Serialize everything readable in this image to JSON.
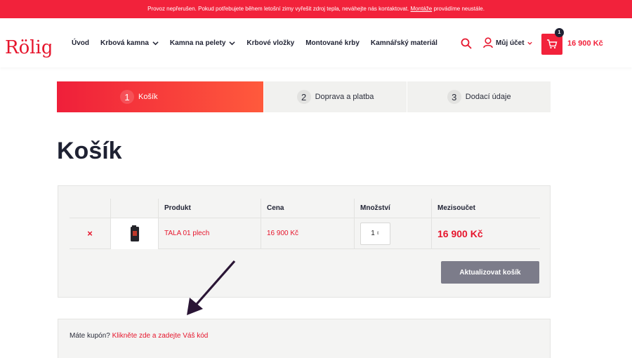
{
  "topbar": {
    "text": "Provoz nepřerušen. Pokud potřebujete během letošní zimy vyřešit zdroj tepla, neváhejte nás kontaktovat.",
    "link": "Montáže",
    "suffix": "provádíme neustále."
  },
  "brand": {
    "logo_text": "Rölig",
    "accent": "#f2223b"
  },
  "nav": {
    "items": [
      {
        "label": "Úvod"
      },
      {
        "label": "Krbová kamna"
      },
      {
        "label": "Kamna na pelety"
      },
      {
        "label": "Krbové vložky"
      },
      {
        "label": "Montované krby"
      },
      {
        "label": "Kamnářský materiál"
      }
    ],
    "account_label": "Můj účet",
    "cart_count": "1",
    "cart_total": "16 900 Kč"
  },
  "steps": [
    {
      "num": "1",
      "label": "Košík"
    },
    {
      "num": "2",
      "label": "Doprava a platba"
    },
    {
      "num": "3",
      "label": "Dodací údaje"
    }
  ],
  "page_title": "Košík",
  "cart": {
    "headers": {
      "product": "Produkt",
      "price": "Cena",
      "quantity": "Množství",
      "subtotal": "Mezisoučet"
    },
    "items": [
      {
        "remove": "×",
        "name": "TALA 01 plech",
        "price": "16 900 Kč",
        "quantity": "1",
        "subtotal": "16 900 Kč"
      }
    ],
    "update_label": "Aktualizovat košík"
  },
  "coupon": {
    "text": "Máte kupón?",
    "link": "Klikněte zde a zadejte Váš kód"
  }
}
